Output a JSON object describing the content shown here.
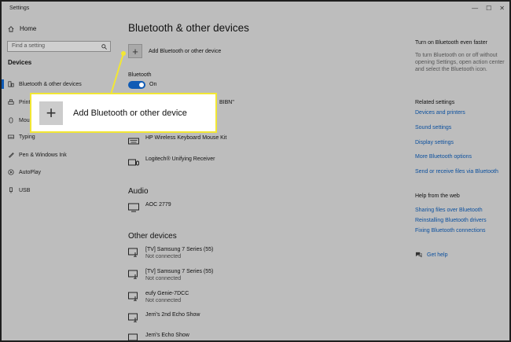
{
  "window": {
    "title": "Settings",
    "controls": [
      "—",
      "☐",
      "✕"
    ]
  },
  "sidebar": {
    "home_label": "Home",
    "search_placeholder": "Find a setting",
    "section_heading": "Devices",
    "items": [
      {
        "label": "Bluetooth & other devices",
        "icon": "bluetooth-devices-icon"
      },
      {
        "label": "Printers & scanners",
        "icon": "printer-icon"
      },
      {
        "label": "Mouse",
        "icon": "mouse-icon"
      },
      {
        "label": "Typing",
        "icon": "keyboard-icon"
      },
      {
        "label": "Pen & Windows Ink",
        "icon": "pen-icon"
      },
      {
        "label": "AutoPlay",
        "icon": "autoplay-icon"
      },
      {
        "label": "USB",
        "icon": "usb-icon"
      }
    ]
  },
  "main": {
    "title": "Bluetooth & other devices",
    "add_device_label": "Add Bluetooth or other device",
    "bluetooth_label": "Bluetooth",
    "toggle_state": "On",
    "hidden_partial": "BIBN\"",
    "input_devices": [
      {
        "name": "HP Wireless Keyboard Mouse Kit"
      },
      {
        "name": "Logitech® Unifying Receiver"
      }
    ],
    "audio_heading": "Audio",
    "audio_devices": [
      {
        "name": "AOC 2779"
      }
    ],
    "other_heading": "Other devices",
    "other_devices": [
      {
        "name": "[TV] Samsung 7 Series (55)",
        "status": "Not connected"
      },
      {
        "name": "[TV] Samsung 7 Series (55)",
        "status": "Not connected"
      },
      {
        "name": "eufy Genie-7DCC",
        "status": "Not connected"
      },
      {
        "name": "Jerri's 2nd Echo Show",
        "status": ""
      },
      {
        "name": "Jerri's Echo Show",
        "status": ""
      }
    ]
  },
  "right_panel": {
    "faster_heading": "Turn on Bluetooth even faster",
    "faster_text": "To turn Bluetooth on or off without opening Settings, open action center and select the Bluetooth icon.",
    "related_heading": "Related settings",
    "related_links": [
      "Devices and printers",
      "Sound settings",
      "Display settings",
      "More Bluetooth options",
      "Send or receive files via Bluetooth"
    ],
    "help_heading": "Help from the web",
    "help_links": [
      "Sharing files over Bluetooth",
      "Reinstalling Bluetooth drivers",
      "Fixing Bluetooth connections"
    ],
    "get_help_label": "Get help"
  },
  "callout": {
    "label": "Add Bluetooth or other device"
  },
  "colors": {
    "accent": "#0f5bb5",
    "link": "#0a4f9e",
    "highlight_border": "#f2e733",
    "dimmed_background": "#bdbdbd"
  }
}
